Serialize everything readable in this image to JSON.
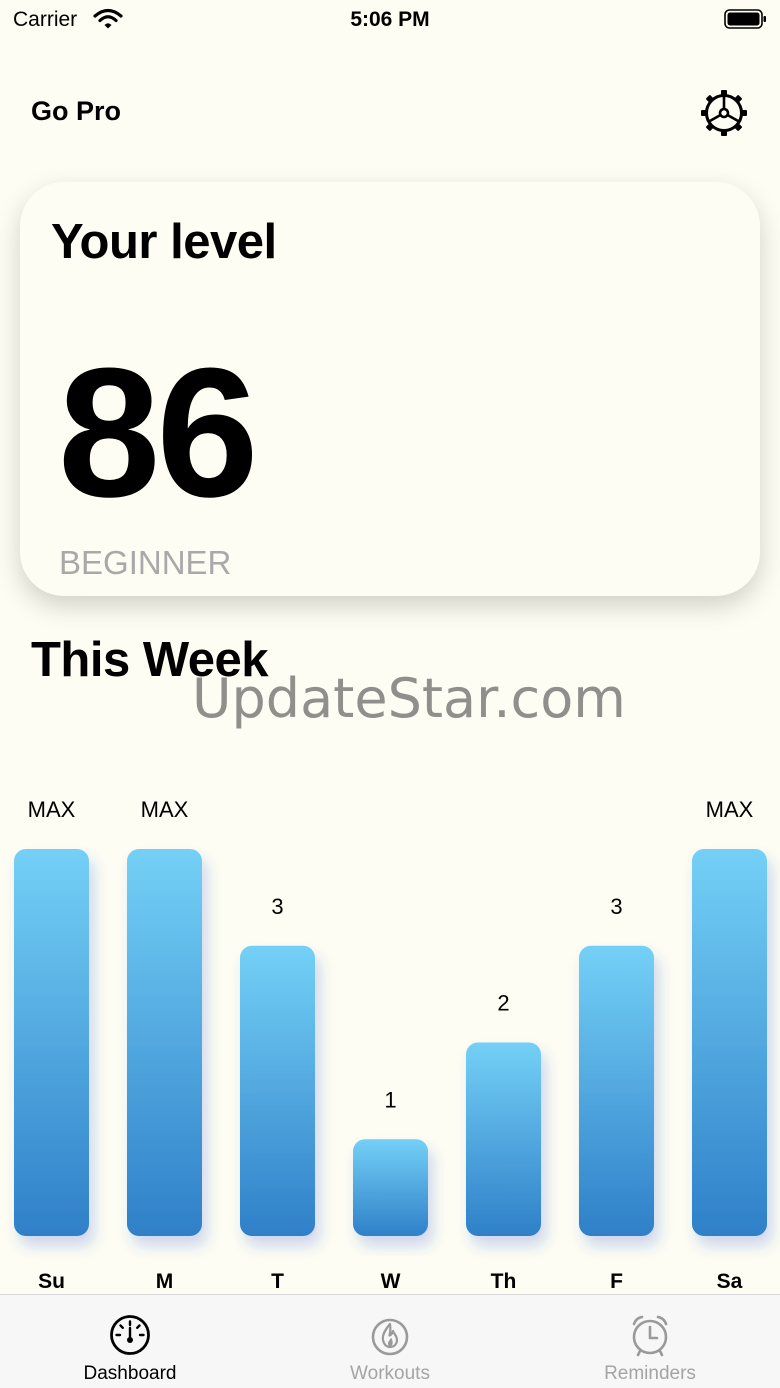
{
  "status_bar": {
    "carrier": "Carrier",
    "time": "5:06 PM"
  },
  "header": {
    "go_pro_label": "Go Pro",
    "settings_icon": "gear-icon"
  },
  "level_card": {
    "title": "Your level",
    "value": "86",
    "rank": "BEGINNER"
  },
  "week": {
    "title": "This Week"
  },
  "watermark": "UpdateStar.com",
  "colors": {
    "background": "#fdfdf3",
    "bar_top": "#74d0f6",
    "bar_bottom": "#2f80c8",
    "inactive_tab": "#a4a4a4"
  },
  "chart_data": {
    "type": "bar",
    "categories": [
      "Su",
      "M",
      "T",
      "W",
      "Th",
      "F",
      "Sa"
    ],
    "values": [
      4,
      4,
      3,
      1,
      2,
      3,
      4
    ],
    "labels": [
      "MAX",
      "MAX",
      "3",
      "1",
      "2",
      "3",
      "MAX"
    ],
    "ylim": [
      0,
      4
    ],
    "grid": false,
    "title": "",
    "xlabel": "",
    "ylabel": ""
  },
  "tab_bar": {
    "tabs": [
      {
        "label": "Dashboard",
        "icon": "gauge-icon",
        "active": true
      },
      {
        "label": "Workouts",
        "icon": "flame-icon",
        "active": false
      },
      {
        "label": "Reminders",
        "icon": "alarm-clock-icon",
        "active": false
      }
    ]
  }
}
